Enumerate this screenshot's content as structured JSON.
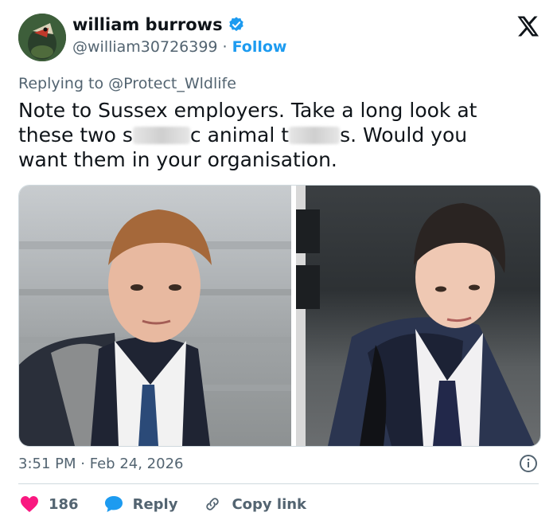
{
  "author": {
    "name": "william burrows",
    "handle": "@william30726399",
    "separator": "·",
    "follow_label": "Follow",
    "verified": true,
    "avatar_icon": "bird-avatar"
  },
  "brand": {
    "logo_icon": "x-logo"
  },
  "reply_context": {
    "prefix": "Replying to",
    "mention": "@Protect_Wldlife"
  },
  "tweet": {
    "line1": "Note to Sussex employers. Take a long look at",
    "line2_a": "these two  s",
    "line2_b": "c animal t",
    "line2_c": "s. Would you",
    "line3": "want them in your organisation."
  },
  "media": {
    "photos": [
      {
        "name": "photo-left",
        "description_icon": "portrait-photo"
      },
      {
        "name": "photo-right",
        "description_icon": "portrait-photo"
      }
    ]
  },
  "meta": {
    "time": "3:51 PM",
    "separator": "·",
    "date": "Feb 24, 2026"
  },
  "actions": {
    "like_count": "186",
    "reply_label": "Reply",
    "copy_label": "Copy link"
  },
  "colors": {
    "accent": "#1d9bf0",
    "like": "#f91880",
    "text": "#0f1419",
    "muted": "#536471"
  }
}
